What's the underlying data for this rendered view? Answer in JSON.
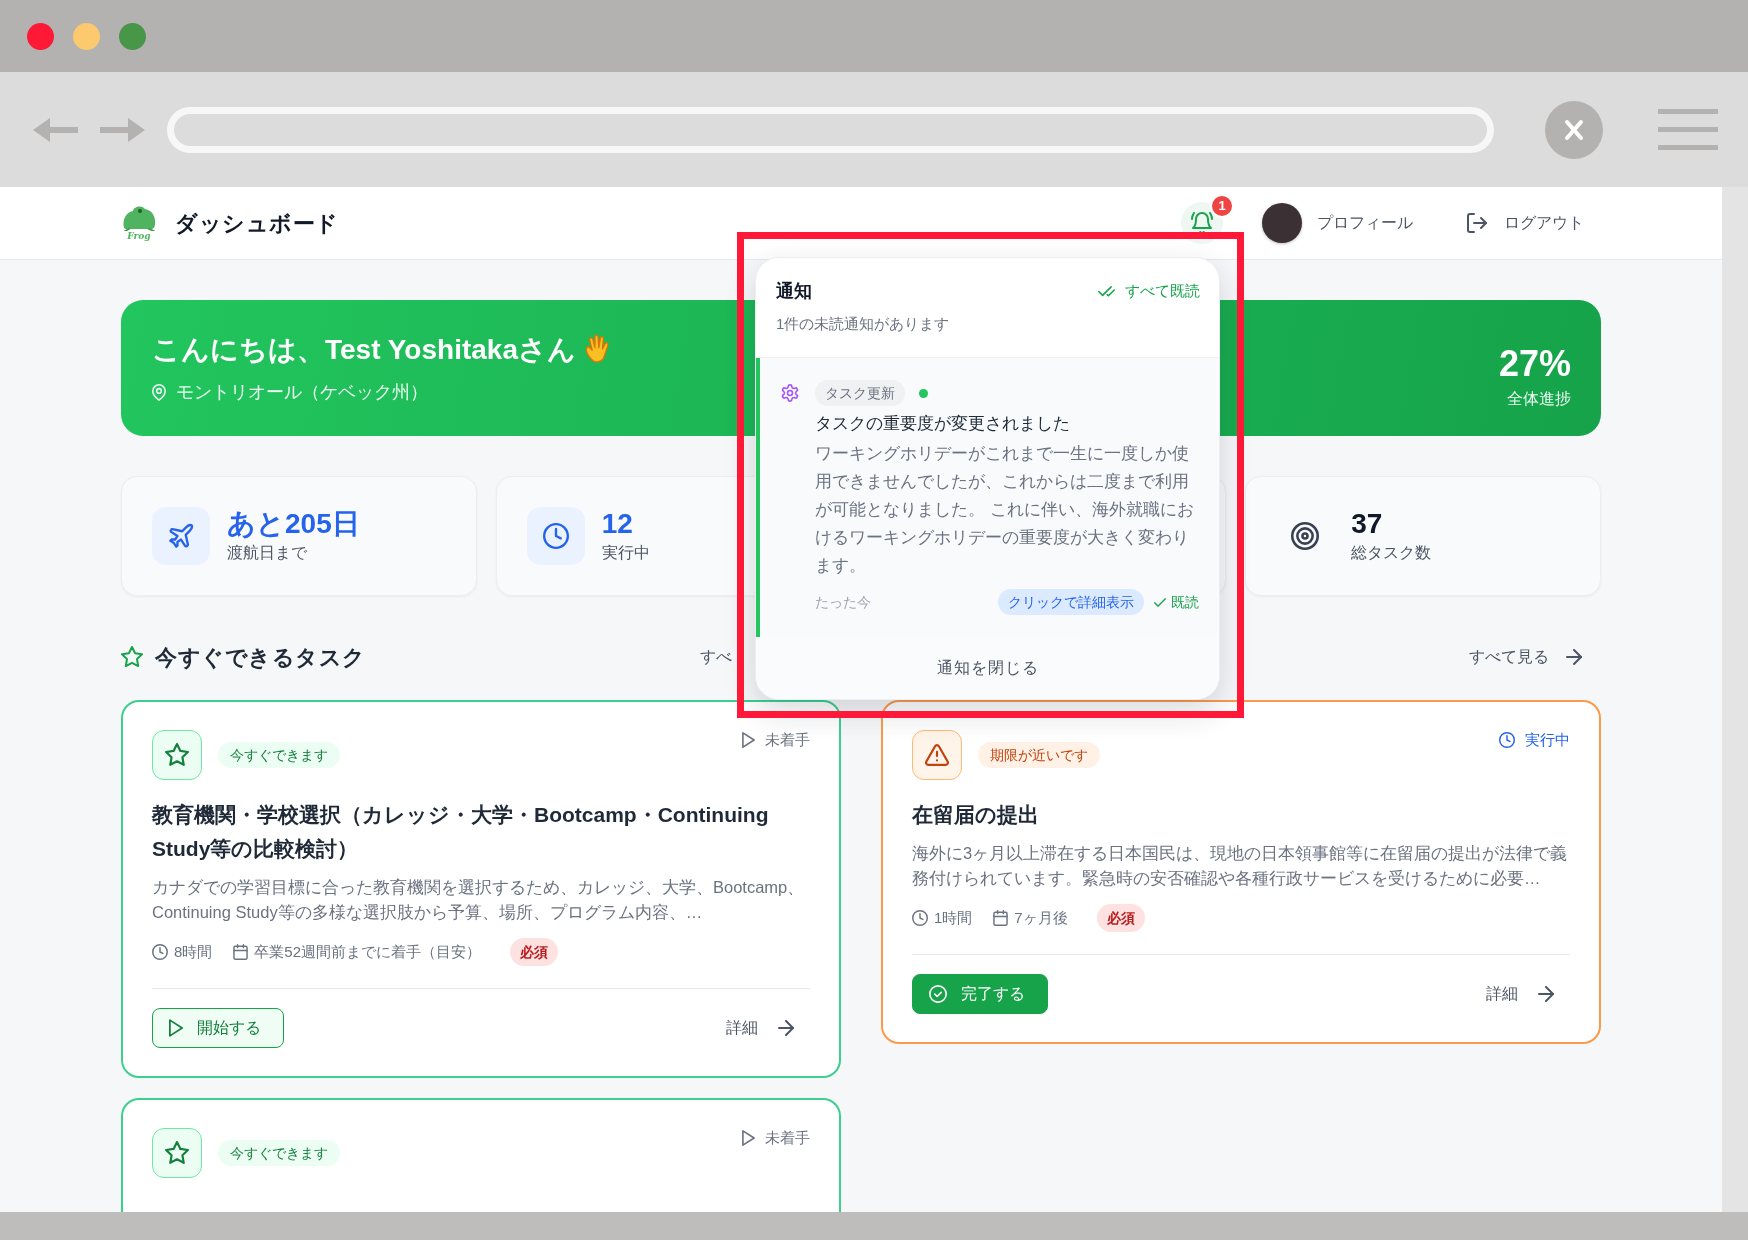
{
  "header": {
    "logo_text": "Frog",
    "title": "ダッシュボード",
    "notification_count": "1",
    "profile": "プロフィール",
    "logout": "ログアウト"
  },
  "banner": {
    "greeting": "こんにちは、Test Yoshitakaさん",
    "location": "モントリオール（ケベック州）",
    "progress": "27%",
    "progress_label": "全体進捗"
  },
  "stats": [
    {
      "kind": "departure",
      "value": "あと205日",
      "label": "渡航日まで"
    },
    {
      "kind": "active",
      "value": "12",
      "label": "実行中"
    },
    {
      "kind": "covered"
    },
    {
      "kind": "total",
      "value": "37",
      "label": "総タスク数"
    }
  ],
  "sections": [
    {
      "title": "今すぐできるタスク",
      "link": {
        "label": "すべ",
        "arrow": false
      },
      "cards": [
        {
          "kind": "available",
          "badge": "今すぐできます",
          "in_progress": false,
          "status": "未着手",
          "title": "教育機関・学校選択（カレッジ・大学・Bootcamp・Continuing Study等の比較検討）",
          "description": "カナダでの学習目標に合った教育機関を選択するため、カレッジ、大学、Bootcamp、Continuing Study等の多様な選択肢から予算、場所、プログラム内容、…",
          "duration": "8時間",
          "due": "卒業52週間前までに着手（目安）",
          "tag": "必須",
          "action": "開始する",
          "details": "詳細"
        },
        {
          "kind": "available",
          "badge": "今すぐできます",
          "in_progress": false,
          "status": "未着手"
        }
      ]
    },
    {
      "link": {
        "label": "すべて見る",
        "arrow": true
      },
      "cards": [
        {
          "kind": "due_soon",
          "badge": "期限が近いです",
          "in_progress": true,
          "status": "実行中",
          "title": "在留届の提出",
          "description": "海外に3ヶ月以上滞在する日本国民は、現地の日本領事館等に在留届の提出が法律で義務付けられています。緊急時の安否確認や各種行政サービスを受けるために必要…",
          "duration": "1時間",
          "due": "7ヶ月後",
          "tag": "必須",
          "action": "完了する",
          "details": "詳細"
        }
      ]
    }
  ],
  "notifications": {
    "title": "通知",
    "mark_all": "すべて既読",
    "summary": "1件の未読通知があります",
    "items": [
      {
        "kind": "task_update",
        "unread": true,
        "tag": "タスク更新",
        "title": "タスクの重要度が変更されました",
        "body": "ワーキングホリデーがこれまで一生に一度しか使用できませんでしたが、これからは二度まで利用が可能となりました。 これに伴い、海外就職におけるワーキングホリデーの重要度が大きく変わります。",
        "time": "たった今",
        "details": "クリックで詳細表示",
        "mark_read": "既読"
      }
    ],
    "close": "通知を閉じる"
  }
}
